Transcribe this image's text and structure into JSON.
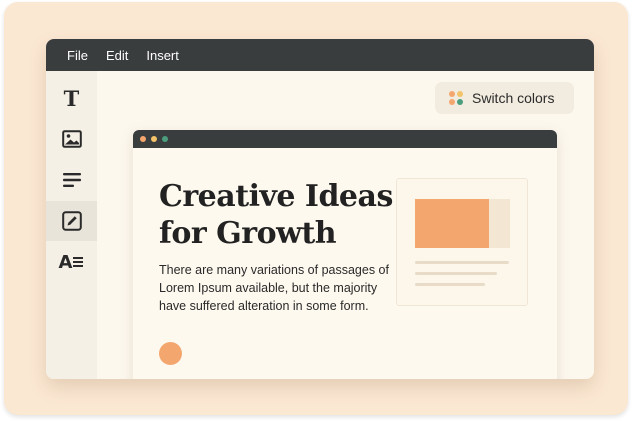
{
  "menubar": {
    "items": [
      {
        "label": "File"
      },
      {
        "label": "Edit"
      },
      {
        "label": "Insert"
      }
    ]
  },
  "sidebar": {
    "tools": [
      {
        "icon": "text-tool-icon",
        "glyph": "T"
      },
      {
        "icon": "image-tool-icon"
      },
      {
        "icon": "align-left-tool-icon"
      },
      {
        "icon": "edit-tool-icon",
        "active": true
      },
      {
        "icon": "text-style-tool-icon",
        "glyph": "A"
      }
    ]
  },
  "toolbar": {
    "switch_colors_label": "Switch colors"
  },
  "preview": {
    "headline": "Creative Ideas for Growth",
    "body": "There are many variations of passages of Lorem Ipsum available, but the majority have suffered alteration in some form."
  },
  "colors": {
    "accent_orange": "#f4a66f",
    "dark_bar": "#3a3d3e",
    "dot_yellow": "#f2c36b",
    "dot_green": "#4a9e7e"
  }
}
